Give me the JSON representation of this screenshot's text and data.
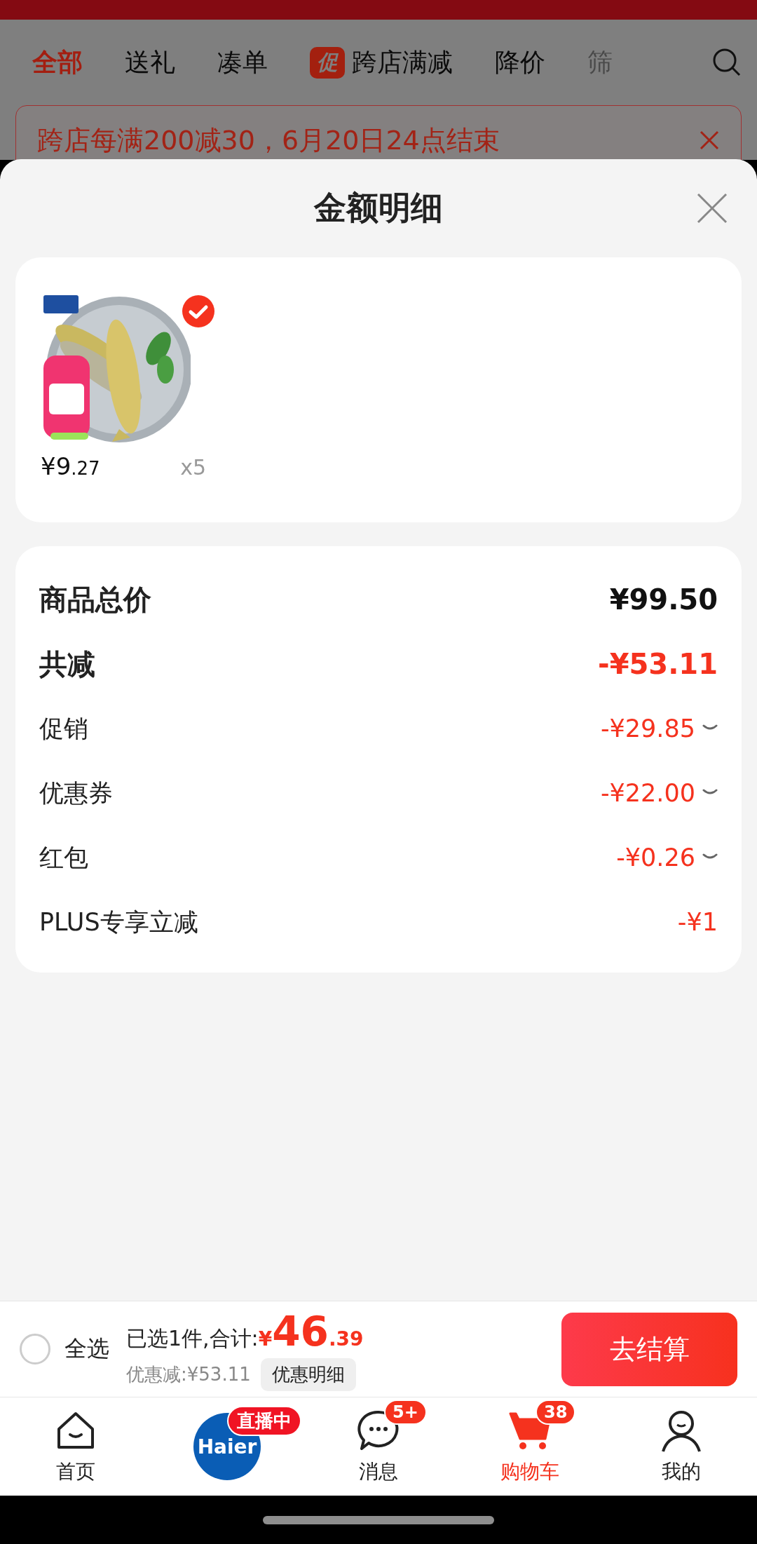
{
  "background": {
    "tabs": [
      {
        "label": "全部",
        "selected": true,
        "faded": false
      },
      {
        "label": "送礼",
        "selected": false,
        "faded": false
      },
      {
        "label": "凑单",
        "selected": false,
        "faded": false
      },
      {
        "label": "跨店满减",
        "badge": "促",
        "selected": false,
        "faded": false
      },
      {
        "label": "降价",
        "selected": false,
        "faded": false
      },
      {
        "label": "筛",
        "selected": false,
        "faded": true
      }
    ],
    "banner": "跨店每满200减30，6月20日24点结束"
  },
  "sheet": {
    "title": "金额明细",
    "products": [
      {
        "kind": "picture",
        "checked": true,
        "price_main": "¥9",
        "price_cents": ".27",
        "quantity": "x5"
      }
    ],
    "summary": [
      {
        "kind": "total",
        "label": "商品总价",
        "amount": "¥99.50",
        "expandable": false
      },
      {
        "kind": "total_discount",
        "label": "共减",
        "amount": "-¥53.11",
        "expandable": false
      },
      {
        "kind": "detail",
        "label": "促销",
        "amount": "-¥29.85",
        "expandable": true
      },
      {
        "kind": "detail",
        "label": "优惠券",
        "amount": "-¥22.00",
        "expandable": true
      },
      {
        "kind": "detail",
        "label": "红包",
        "amount": "-¥0.26",
        "expandable": true
      },
      {
        "kind": "detail",
        "label": "PLUS专享立减",
        "amount": "-¥1",
        "expandable": false
      }
    ]
  },
  "checkout": {
    "select_all": {
      "label": "全选",
      "checked": false
    },
    "summary": "已选1件,合计:",
    "currency": "¥",
    "total_main": "46",
    "total_cents": ".39",
    "discount": "优惠减:¥53.11",
    "details_button": "优惠明细",
    "submit": "去结算"
  },
  "nav": [
    {
      "kind": "home",
      "label": "首页",
      "selected": false
    },
    {
      "kind": "live",
      "logo": "Haier",
      "badge": "直播中",
      "selected": false
    },
    {
      "kind": "messages",
      "label": "消息",
      "badge": "5+",
      "selected": false
    },
    {
      "kind": "cart",
      "label": "购物车",
      "badge": "38",
      "selected": true
    },
    {
      "kind": "profile",
      "label": "我的",
      "selected": false
    }
  ]
}
